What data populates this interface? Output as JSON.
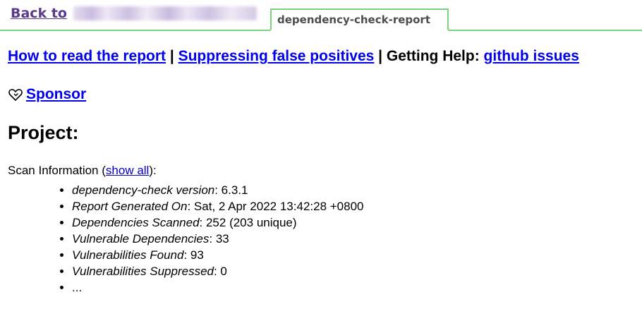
{
  "header": {
    "back_label": "Back to",
    "tab_label": "dependency-check-report"
  },
  "links": {
    "how_to_read": "How to read the report",
    "separator1": " | ",
    "suppressing": "Suppressing false positives",
    "separator2": " | Getting Help: ",
    "github_issues": "github issues"
  },
  "sponsor": {
    "icon": "heart-icon",
    "label": "Sponsor"
  },
  "project": {
    "title": "Project:"
  },
  "scan_info": {
    "label_prefix": "Scan Information (",
    "show_all": "show all",
    "label_suffix": "):",
    "items": [
      {
        "key": "dependency-check version",
        "value": ": 6.3.1"
      },
      {
        "key": "Report Generated On",
        "value": ": Sat, 2 Apr 2022 13:42:28 +0800"
      },
      {
        "key": "Dependencies Scanned",
        "value": ": 252 (203 unique)"
      },
      {
        "key": "Vulnerable Dependencies",
        "value": ": 33"
      },
      {
        "key": "Vulnerabilities Found",
        "value": ": 93"
      },
      {
        "key": "Vulnerabilities Suppressed",
        "value": ": 0"
      },
      {
        "key": "",
        "value": "..."
      }
    ]
  },
  "colors": {
    "accent_green": "#7cd17c",
    "link_blue": "#0000ee",
    "visited_purple": "#5b3a8c"
  }
}
